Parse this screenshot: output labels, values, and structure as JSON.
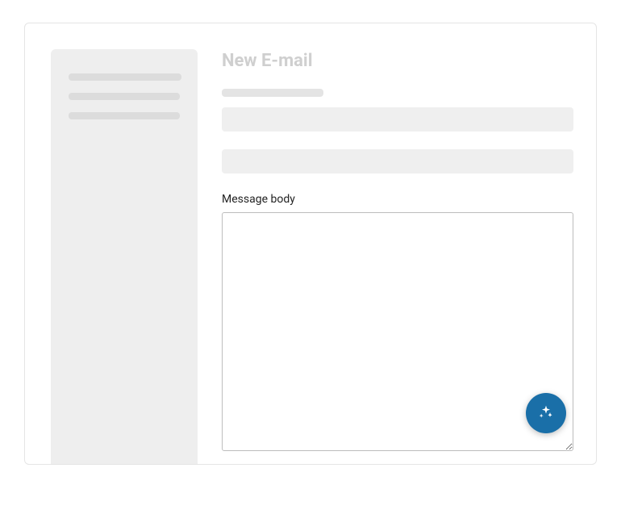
{
  "page": {
    "title": "New E-mail"
  },
  "form": {
    "message_label": "Message body",
    "message_value": ""
  },
  "fab": {
    "icon": "sparkle-icon"
  }
}
